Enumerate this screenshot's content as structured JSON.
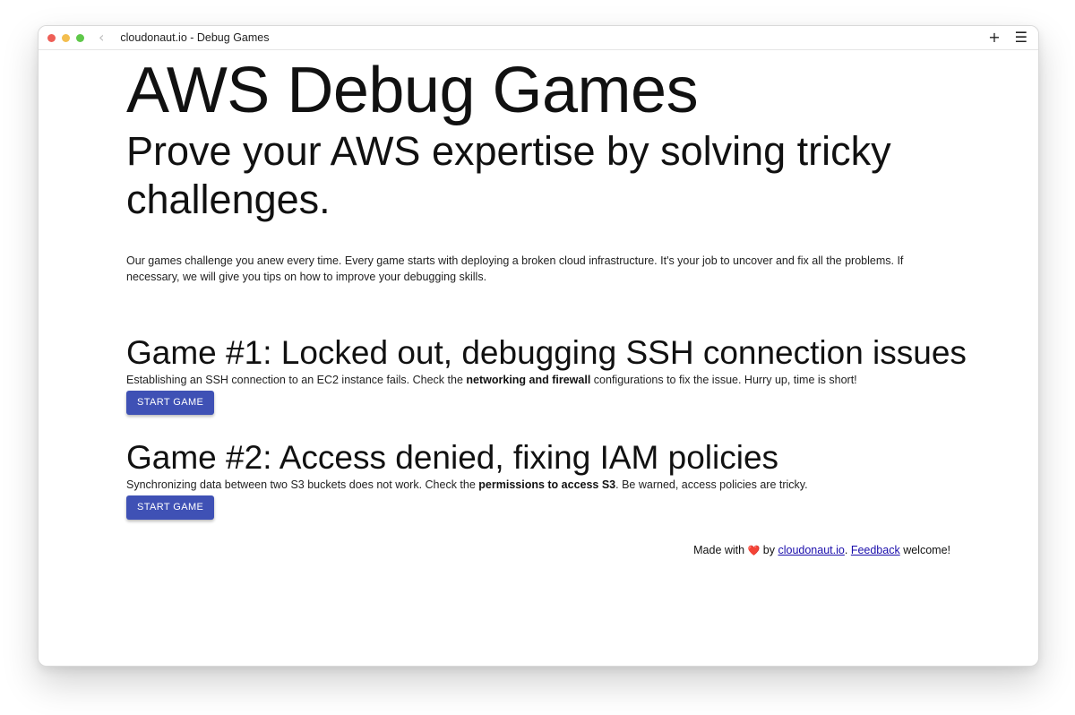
{
  "colors": {
    "close": "#ee5f57",
    "minimize": "#f3be4f",
    "maximize": "#5fc84a",
    "button_bg": "#3f51b5",
    "link": "#1a0dab",
    "heart": "#e53935"
  },
  "window": {
    "title": "cloudonaut.io - Debug Games",
    "back_icon": "chevron-left-icon",
    "new_tab_icon": "plus-icon",
    "menu_icon": "hamburger-menu-icon"
  },
  "hero": {
    "title": "AWS Debug Games",
    "subtitle": "Prove your AWS expertise by solving tricky challenges.",
    "intro": "Our games challenge you anew every time. Every game starts with deploying a broken cloud infrastructure. It's your job to uncover and fix all the problems. If necessary, we will give you tips on how to improve your debugging skills."
  },
  "games": [
    {
      "title": "Game #1: Locked out, debugging SSH connection issues",
      "desc_before": "Establishing an SSH connection to an EC2 instance fails. Check the ",
      "desc_bold": "networking and firewall",
      "desc_after": " configurations to fix the issue. Hurry up, time is short!",
      "button": "START GAME"
    },
    {
      "title": "Game #2: Access denied, fixing IAM policies",
      "desc_before": "Synchronizing data between two S3 buckets does not work. Check the ",
      "desc_bold": "permissions to access S3",
      "desc_after": ". Be warned, access policies are tricky.",
      "button": "START GAME"
    }
  ],
  "footer": {
    "made_with": "Made with",
    "heart": "❤️",
    "by": "by",
    "site_link": "cloudonaut.io",
    "period": ".",
    "feedback_link": "Feedback",
    "welcome": "welcome!"
  }
}
